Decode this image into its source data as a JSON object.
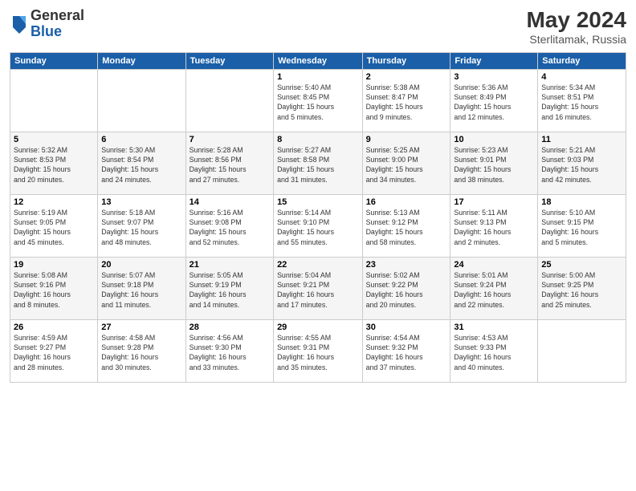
{
  "header": {
    "logo_general": "General",
    "logo_blue": "Blue",
    "month_year": "May 2024",
    "location": "Sterlitamak, Russia"
  },
  "weekdays": [
    "Sunday",
    "Monday",
    "Tuesday",
    "Wednesday",
    "Thursday",
    "Friday",
    "Saturday"
  ],
  "weeks": [
    [
      {
        "day": "",
        "info": ""
      },
      {
        "day": "",
        "info": ""
      },
      {
        "day": "",
        "info": ""
      },
      {
        "day": "1",
        "info": "Sunrise: 5:40 AM\nSunset: 8:45 PM\nDaylight: 15 hours\nand 5 minutes."
      },
      {
        "day": "2",
        "info": "Sunrise: 5:38 AM\nSunset: 8:47 PM\nDaylight: 15 hours\nand 9 minutes."
      },
      {
        "day": "3",
        "info": "Sunrise: 5:36 AM\nSunset: 8:49 PM\nDaylight: 15 hours\nand 12 minutes."
      },
      {
        "day": "4",
        "info": "Sunrise: 5:34 AM\nSunset: 8:51 PM\nDaylight: 15 hours\nand 16 minutes."
      }
    ],
    [
      {
        "day": "5",
        "info": "Sunrise: 5:32 AM\nSunset: 8:53 PM\nDaylight: 15 hours\nand 20 minutes."
      },
      {
        "day": "6",
        "info": "Sunrise: 5:30 AM\nSunset: 8:54 PM\nDaylight: 15 hours\nand 24 minutes."
      },
      {
        "day": "7",
        "info": "Sunrise: 5:28 AM\nSunset: 8:56 PM\nDaylight: 15 hours\nand 27 minutes."
      },
      {
        "day": "8",
        "info": "Sunrise: 5:27 AM\nSunset: 8:58 PM\nDaylight: 15 hours\nand 31 minutes."
      },
      {
        "day": "9",
        "info": "Sunrise: 5:25 AM\nSunset: 9:00 PM\nDaylight: 15 hours\nand 34 minutes."
      },
      {
        "day": "10",
        "info": "Sunrise: 5:23 AM\nSunset: 9:01 PM\nDaylight: 15 hours\nand 38 minutes."
      },
      {
        "day": "11",
        "info": "Sunrise: 5:21 AM\nSunset: 9:03 PM\nDaylight: 15 hours\nand 42 minutes."
      }
    ],
    [
      {
        "day": "12",
        "info": "Sunrise: 5:19 AM\nSunset: 9:05 PM\nDaylight: 15 hours\nand 45 minutes."
      },
      {
        "day": "13",
        "info": "Sunrise: 5:18 AM\nSunset: 9:07 PM\nDaylight: 15 hours\nand 48 minutes."
      },
      {
        "day": "14",
        "info": "Sunrise: 5:16 AM\nSunset: 9:08 PM\nDaylight: 15 hours\nand 52 minutes."
      },
      {
        "day": "15",
        "info": "Sunrise: 5:14 AM\nSunset: 9:10 PM\nDaylight: 15 hours\nand 55 minutes."
      },
      {
        "day": "16",
        "info": "Sunrise: 5:13 AM\nSunset: 9:12 PM\nDaylight: 15 hours\nand 58 minutes."
      },
      {
        "day": "17",
        "info": "Sunrise: 5:11 AM\nSunset: 9:13 PM\nDaylight: 16 hours\nand 2 minutes."
      },
      {
        "day": "18",
        "info": "Sunrise: 5:10 AM\nSunset: 9:15 PM\nDaylight: 16 hours\nand 5 minutes."
      }
    ],
    [
      {
        "day": "19",
        "info": "Sunrise: 5:08 AM\nSunset: 9:16 PM\nDaylight: 16 hours\nand 8 minutes."
      },
      {
        "day": "20",
        "info": "Sunrise: 5:07 AM\nSunset: 9:18 PM\nDaylight: 16 hours\nand 11 minutes."
      },
      {
        "day": "21",
        "info": "Sunrise: 5:05 AM\nSunset: 9:19 PM\nDaylight: 16 hours\nand 14 minutes."
      },
      {
        "day": "22",
        "info": "Sunrise: 5:04 AM\nSunset: 9:21 PM\nDaylight: 16 hours\nand 17 minutes."
      },
      {
        "day": "23",
        "info": "Sunrise: 5:02 AM\nSunset: 9:22 PM\nDaylight: 16 hours\nand 20 minutes."
      },
      {
        "day": "24",
        "info": "Sunrise: 5:01 AM\nSunset: 9:24 PM\nDaylight: 16 hours\nand 22 minutes."
      },
      {
        "day": "25",
        "info": "Sunrise: 5:00 AM\nSunset: 9:25 PM\nDaylight: 16 hours\nand 25 minutes."
      }
    ],
    [
      {
        "day": "26",
        "info": "Sunrise: 4:59 AM\nSunset: 9:27 PM\nDaylight: 16 hours\nand 28 minutes."
      },
      {
        "day": "27",
        "info": "Sunrise: 4:58 AM\nSunset: 9:28 PM\nDaylight: 16 hours\nand 30 minutes."
      },
      {
        "day": "28",
        "info": "Sunrise: 4:56 AM\nSunset: 9:30 PM\nDaylight: 16 hours\nand 33 minutes."
      },
      {
        "day": "29",
        "info": "Sunrise: 4:55 AM\nSunset: 9:31 PM\nDaylight: 16 hours\nand 35 minutes."
      },
      {
        "day": "30",
        "info": "Sunrise: 4:54 AM\nSunset: 9:32 PM\nDaylight: 16 hours\nand 37 minutes."
      },
      {
        "day": "31",
        "info": "Sunrise: 4:53 AM\nSunset: 9:33 PM\nDaylight: 16 hours\nand 40 minutes."
      },
      {
        "day": "",
        "info": ""
      }
    ]
  ]
}
